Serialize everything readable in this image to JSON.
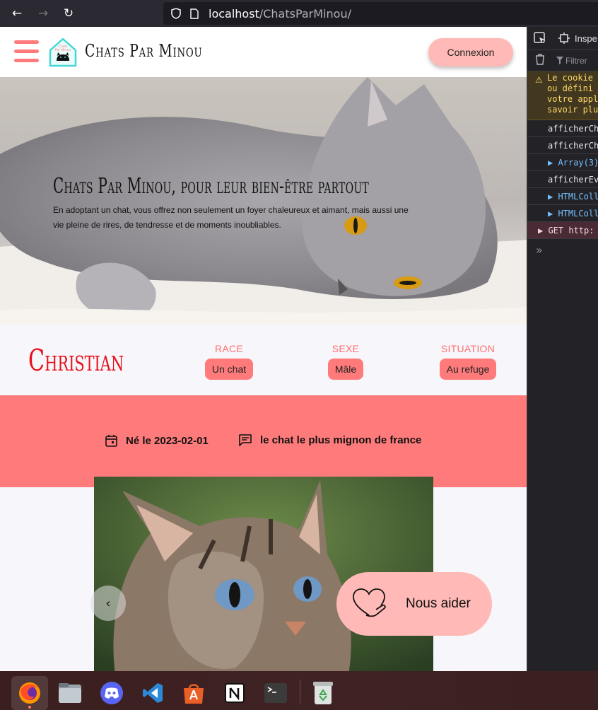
{
  "browser": {
    "url_host": "localhost",
    "url_path": "/ChatsParMinou/"
  },
  "header": {
    "site_title": "Chats Par Minou",
    "login_label": "Connexion"
  },
  "hero": {
    "title": "Chats Par Minou, pour leur bien-être partout",
    "text": "En adoptant un chat, vous offrez non seulement un foyer chaleureux et aimant, mais aussi une vie pleine de rires, de tendresse et de moments inoubliables."
  },
  "cat": {
    "name": "Christian",
    "attributes": [
      {
        "label": "RACE",
        "value": "Un chat"
      },
      {
        "label": "SEXE",
        "value": "Mâle"
      },
      {
        "label": "SITUATION",
        "value": "Au refuge"
      }
    ],
    "birth": "Né le 2023-02-01",
    "description": "le chat le plus mignon de france"
  },
  "help": {
    "label": "Nous aider"
  },
  "devtools": {
    "tab_label": "Inspe",
    "filter_placeholder": "Filtrer",
    "warning_lines": [
      "Le cookie",
      "ou défini",
      "votre appl",
      "savoir plu"
    ],
    "rows": [
      {
        "text": "afficherCh",
        "kind": "log"
      },
      {
        "text": "afficherCh",
        "kind": "log"
      },
      {
        "text": "▶ Array(3)",
        "kind": "obj"
      },
      {
        "text": "afficherEv",
        "kind": "log"
      },
      {
        "text": "▶ HTMLColl",
        "kind": "obj"
      },
      {
        "text": "▶ HTMLColl",
        "kind": "obj"
      },
      {
        "text": "▶  GET http:",
        "kind": "net"
      }
    ],
    "prompt": "»"
  },
  "taskbar": {
    "apps": [
      "firefox-icon",
      "files-icon",
      "discord-icon",
      "vscode-icon",
      "app-center-icon",
      "notion-icon",
      "terminal-icon",
      "trash-icon"
    ]
  },
  "colors": {
    "accent": "#ff7b7b",
    "accent_light": "#ffb9b6",
    "name_red": "#e8131c"
  }
}
